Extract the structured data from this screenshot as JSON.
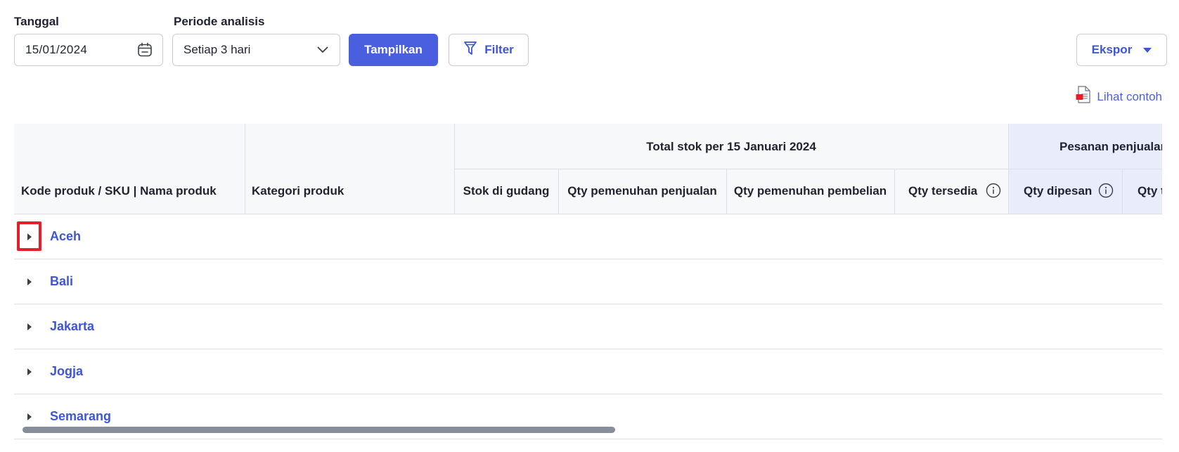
{
  "filters": {
    "date_label": "Tanggal",
    "date_value": "15/01/2024",
    "period_label": "Periode analisis",
    "period_value": "Setiap 3 hari",
    "show_button": "Tampilkan",
    "filter_button": "Filter",
    "export_button": "Ekspor"
  },
  "example_link": "Lihat contoh",
  "table": {
    "group_headers": {
      "total_stock": "Total stok per 15 Januari 2024",
      "sales_orders": "Pesanan penjualan"
    },
    "columns": {
      "product": "Kode produk / SKU | Nama produk",
      "category": "Kategori produk",
      "warehouse_stock": "Stok di gudang",
      "sales_fulfillment": "Qty pemenuhan penjualan",
      "purchase_fulfillment": "Qty pemenuhan pembelian",
      "available": "Qty tersedia",
      "ordered": "Qty dipesan",
      "next_partial": "Qty te"
    },
    "rows": [
      "Aceh",
      "Bali",
      "Jakarta",
      "Jogja",
      "Semarang"
    ]
  },
  "colors": {
    "primary": "#4a5fe0",
    "link": "#3d55d6",
    "highlight": "#e3202a",
    "header_bg": "#f7f8fa",
    "header_alt_bg": "#e9ecfb"
  }
}
